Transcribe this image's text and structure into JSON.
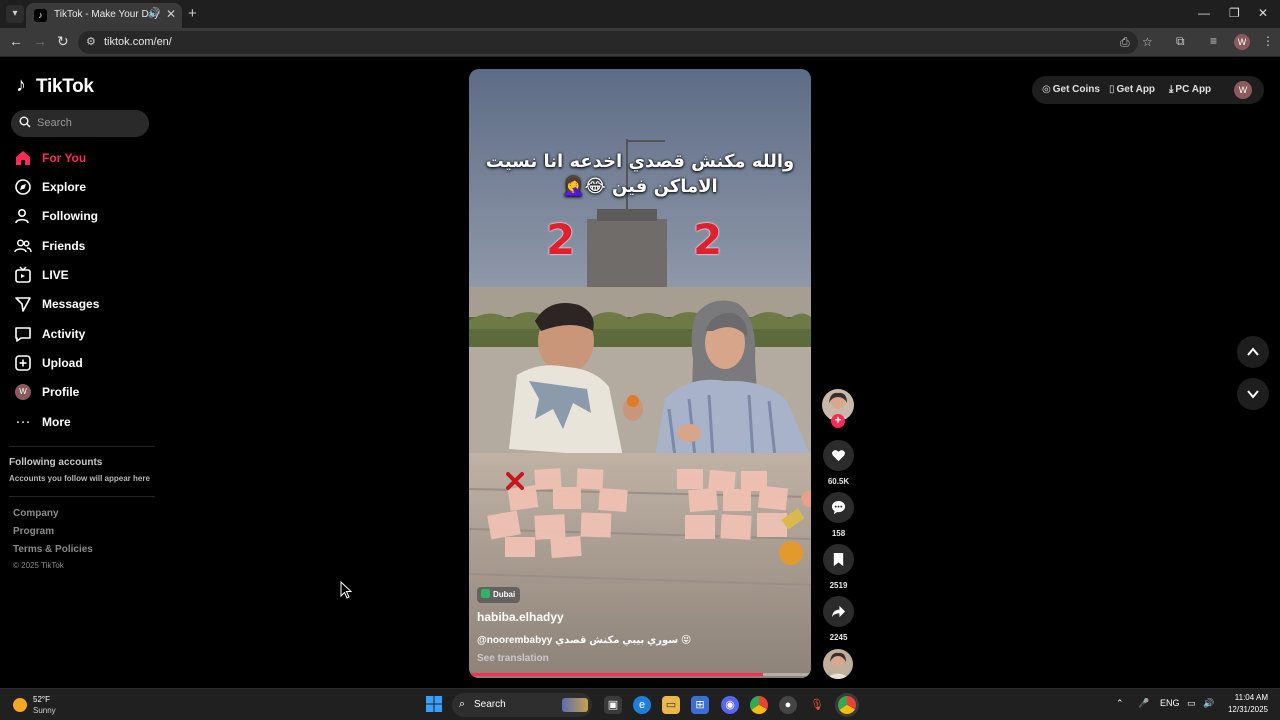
{
  "browser": {
    "tab_title": "TikTok - Make Your Day",
    "url": "tiktok.com/en/",
    "profile_initial": "W"
  },
  "tiktok": {
    "logo": "TikTok",
    "search_placeholder": "Search",
    "nav": [
      {
        "label": "For You",
        "icon": "home-icon",
        "active": true
      },
      {
        "label": "Explore",
        "icon": "compass-icon"
      },
      {
        "label": "Following",
        "icon": "user-icon"
      },
      {
        "label": "Friends",
        "icon": "friends-icon"
      },
      {
        "label": "LIVE",
        "icon": "live-icon"
      },
      {
        "label": "Messages",
        "icon": "send-icon"
      },
      {
        "label": "Activity",
        "icon": "message-box-icon"
      },
      {
        "label": "Upload",
        "icon": "plus-box-icon"
      },
      {
        "label": "Profile",
        "icon": "avatar-icon"
      },
      {
        "label": "More",
        "icon": "more-icon"
      }
    ],
    "profile_initial": "W",
    "following_title": "Following accounts",
    "following_subtitle": "Accounts you follow will appear here",
    "footer": {
      "company": "Company",
      "program": "Program",
      "terms": "Terms & Policies",
      "copyright": "© 2025 TikTok"
    },
    "actions": {
      "get_coins": "Get Coins",
      "get_app": "Get App",
      "pc_app": "PC App",
      "user_initial": "W"
    }
  },
  "video": {
    "caption_line1": "والله مكنش قصدي اخدعه انا نسيت",
    "caption_line2": "الاماكن فين 😂🤦‍♀️",
    "score_left": "2",
    "score_right": "2",
    "location": "Dubai",
    "author": "habiba.elhadyy",
    "description": "@noorembabyy سوري بيبي مكنش قصدي 😝",
    "see_translation": "See translation",
    "progress": 0.86
  },
  "rail": {
    "likes": "60.5K",
    "comments": "158",
    "saves": "2519",
    "shares": "2245"
  },
  "taskbar": {
    "temp": "52°F",
    "weather": "Sunny",
    "search_label": "Search",
    "language": "ENG",
    "time": "11:04 AM",
    "date": "12/31/2025"
  },
  "colors": {
    "accent": "#fe2c55",
    "background": "#000000"
  }
}
